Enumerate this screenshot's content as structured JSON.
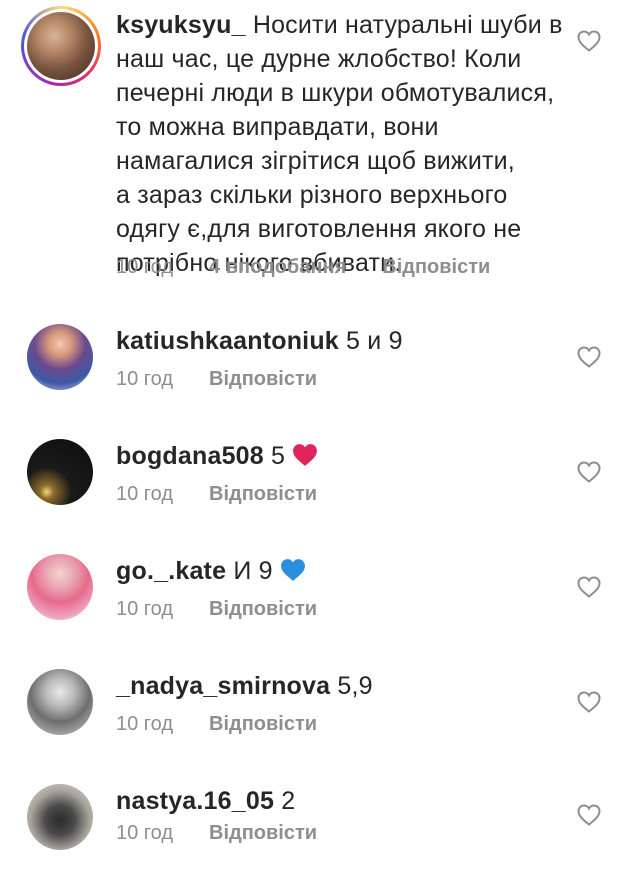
{
  "comments": [
    {
      "username": "ksyuksyu_",
      "text_lines": [
        " Носити натуральні шуби в",
        "наш час, це дурне жлобство!  Коли",
        "печерні люди в шкури обмотувалися,",
        "то можна виправдати, вони",
        "намагалися зігрітися щоб вижити,",
        "а зараз скільки різного верхнього",
        "одягу є,для виготовлення якого не",
        "потрібно нікого вбивати."
      ],
      "time": "10 год",
      "likes": "4 вподобання",
      "reply": "Відповісти"
    },
    {
      "username": "katiushkaantoniuk",
      "text": " 5 и 9",
      "time": "10 год",
      "reply": "Відповісти"
    },
    {
      "username": "bogdana508",
      "text": " 5",
      "emoji": "red-heart",
      "time": "10 год",
      "reply": "Відповісти"
    },
    {
      "username": "go._.kate",
      "text": " И 9",
      "emoji": "blue-heart",
      "time": "10 год",
      "reply": "Відповісти"
    },
    {
      "username": "_nadya_smirnova",
      "text": " 5,9",
      "time": "10 год",
      "reply": "Відповісти"
    },
    {
      "username": "nastya.16_05",
      "text": " 2",
      "time": "10 год",
      "reply": "Відповісти"
    }
  ],
  "colors": {
    "text": "#262626",
    "meta": "#8e8e8e",
    "red_heart": "#e0245e",
    "blue_heart": "#2b8fe0"
  }
}
